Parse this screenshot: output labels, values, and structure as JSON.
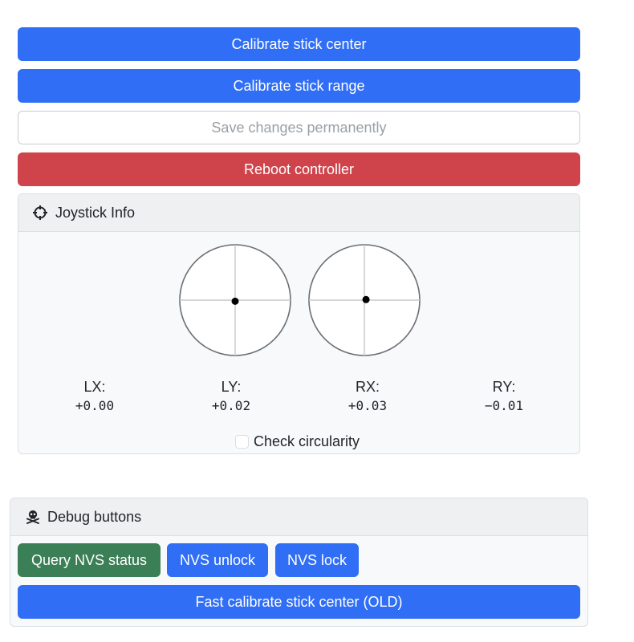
{
  "controls": {
    "calibrate_center": "Calibrate stick center",
    "calibrate_range": "Calibrate stick range",
    "save_permanently": "Save changes permanently",
    "reboot": "Reboot controller"
  },
  "joystick_panel": {
    "title": "Joystick Info",
    "icon": "crosshair-icon",
    "left_stick": {
      "x": 0.0,
      "y": 0.02
    },
    "right_stick": {
      "x": 0.03,
      "y": -0.01
    },
    "axes": [
      {
        "label": "LX:",
        "value": "+0.00"
      },
      {
        "label": "LY:",
        "value": "+0.02"
      },
      {
        "label": "RX:",
        "value": "+0.03"
      },
      {
        "label": "RY:",
        "value": "−0.01"
      }
    ],
    "check_circularity": {
      "label": "Check circularity",
      "checked": false
    }
  },
  "debug_panel": {
    "title": "Debug buttons",
    "icon": "skull-crossbones-icon",
    "query_nvs": "Query NVS status",
    "nvs_unlock": "NVS unlock",
    "nvs_lock": "NVS lock",
    "fast_calibrate": "Fast calibrate stick center (OLD)"
  },
  "colors": {
    "primary": "#2f6ef5",
    "danger": "#cf434b",
    "success": "#3b7f56",
    "panel_bg": "#f8f9fa",
    "panel_header": "#eff0f2"
  }
}
